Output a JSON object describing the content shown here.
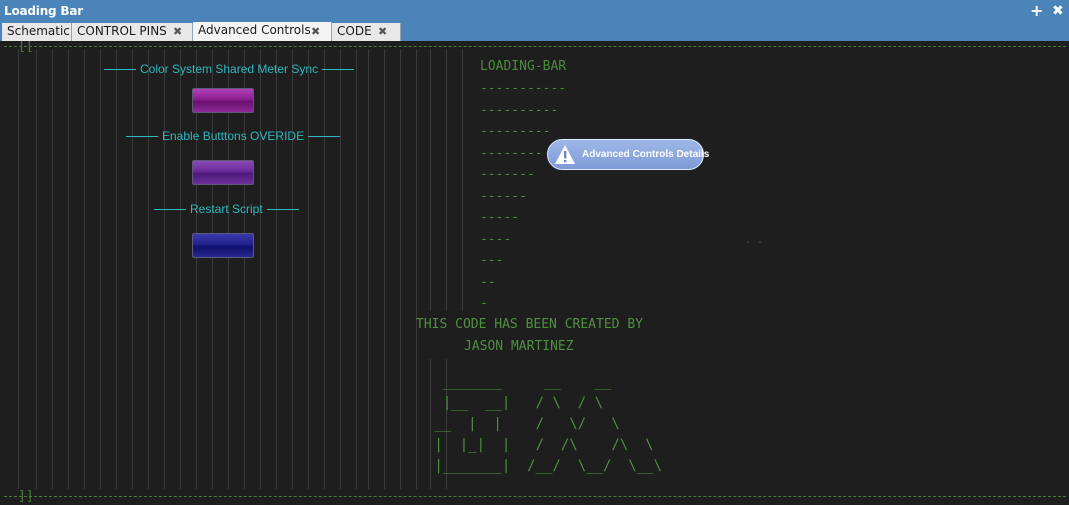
{
  "window": {
    "title": "Loading Bar",
    "add_icon": "+",
    "close_icon": "✖"
  },
  "tabs": [
    {
      "label": "Schematic",
      "closable": false
    },
    {
      "label": "CONTROL PINS",
      "closable": true
    },
    {
      "label": "Advanced Controls",
      "closable": true,
      "active": true
    },
    {
      "label": "CODE",
      "closable": true
    }
  ],
  "tab_close_glyph": "✖",
  "canvas": {
    "border_open": "[[",
    "border_close": "]]",
    "controls": [
      {
        "label": "Color System Shared Meter Sync",
        "button_color": "#8c1e92"
      },
      {
        "label": "Enable Butttons OVERIDE",
        "button_color": "#6a2a98"
      },
      {
        "label": "Restart Script",
        "button_color": "#20208c"
      }
    ],
    "loading_bar": {
      "title": "LOADING-BAR",
      "rows": [
        "-----------",
        "----------",
        "---------",
        "--------",
        "-------",
        "------",
        "-----",
        "----",
        "---",
        "--",
        "-"
      ]
    },
    "stray_text": "- -",
    "credit_line1": "THIS CODE HAS BEEN CREATED BY",
    "credit_line2": "JASON MARTINEZ",
    "ascii_art": [
      "  _______     __    __",
      "  |__  __|   / \\  / \\",
      " __  |  |    /   \\/   \\",
      " |  |_|  |   /  /\\    /\\  \\",
      " |_______|  /__/  \\__/  \\__\\"
    ],
    "tooltip": {
      "label": "Advanced Controls Details",
      "icon": "warning-icon"
    }
  },
  "colors": {
    "titlebar": "#4a84b8",
    "canvas_bg": "#1e1e1e",
    "label_cyan": "#2eb8c0",
    "code_green": "#4b8a3e"
  }
}
